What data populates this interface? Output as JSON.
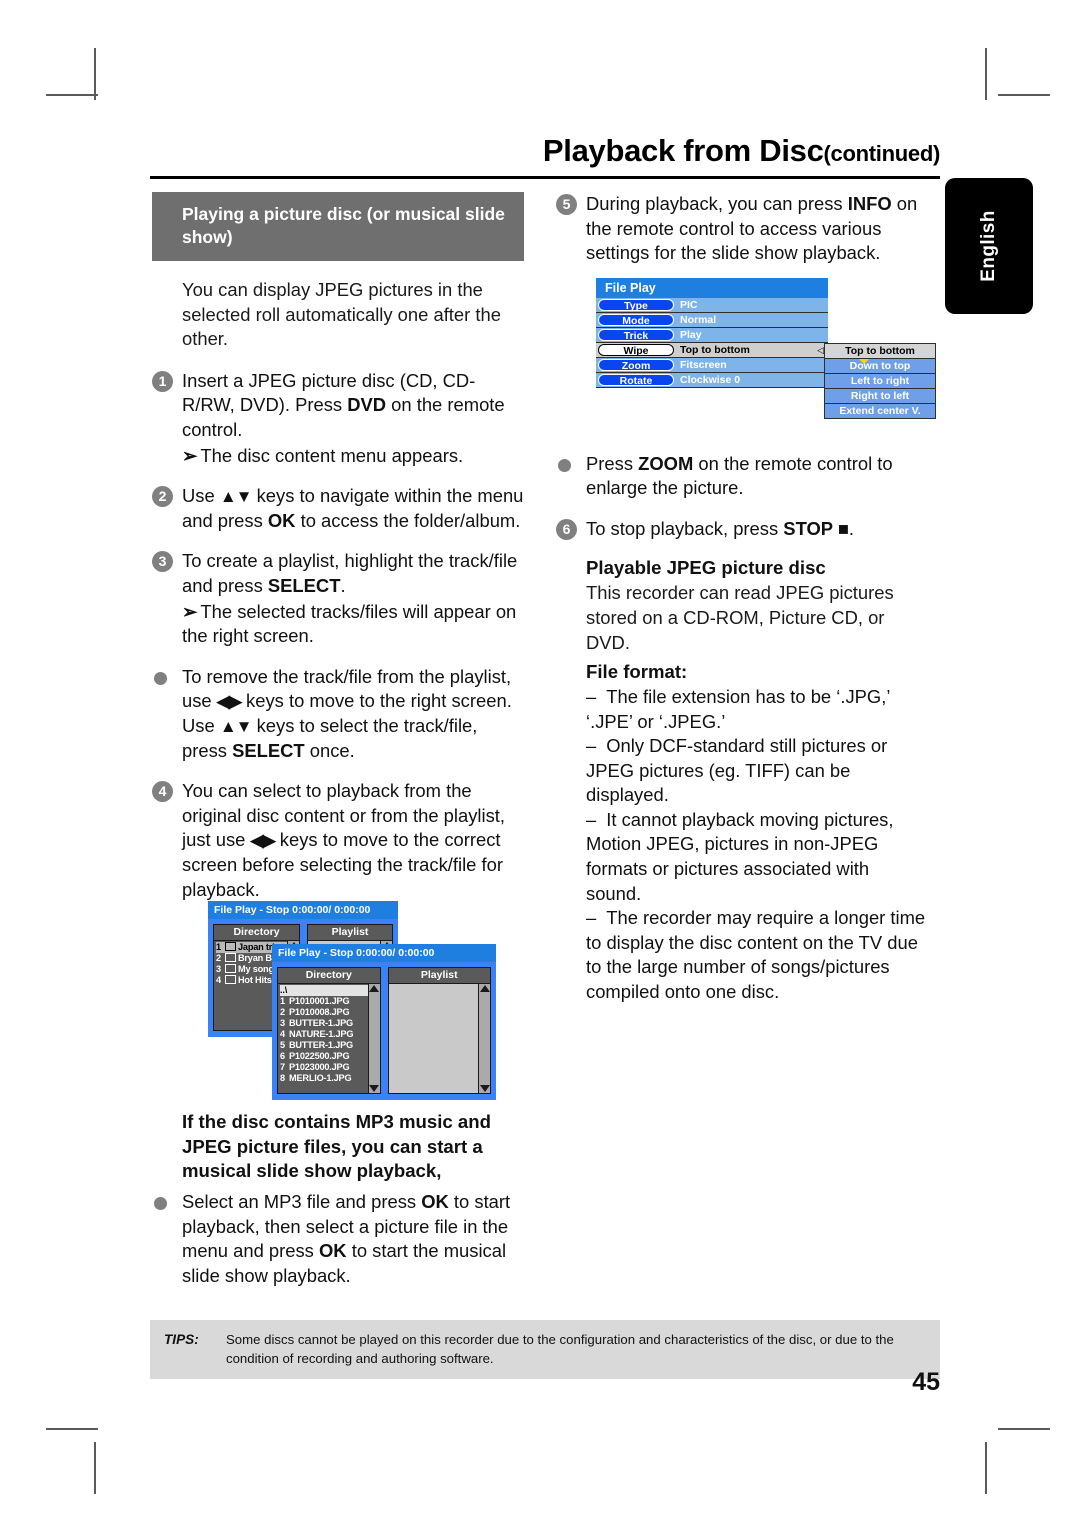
{
  "page": {
    "title": "Playback from Disc",
    "title_suffix": "(continued)",
    "number": "45",
    "language_tab": "English"
  },
  "left_column": {
    "section_heading": "Playing a picture disc (or musical slide show)",
    "intro": "You can display JPEG pictures in the selected roll automatically one after the other.",
    "steps": [
      {
        "marker": "1",
        "text_parts": [
          "Insert a JPEG picture disc (CD, CD-R/RW, DVD). Press ",
          "DVD",
          " on the remote control."
        ],
        "sub": "The disc content menu appears."
      },
      {
        "marker": "2",
        "text_parts": [
          "Use ",
          "▲▼",
          " keys to navigate within the menu and press ",
          "OK",
          " to access the folder/album."
        ]
      },
      {
        "marker": "3",
        "text_parts": [
          "To create a playlist, highlight the track/file and press ",
          "SELECT",
          "."
        ],
        "sub": "The selected tracks/files will appear on the right screen."
      },
      {
        "marker": "bullet",
        "text_parts": [
          "To remove the track/file from the playlist, use ",
          "◀▶",
          " keys to move to the right screen. Use ",
          "▲▼",
          " keys to select the track/file, press ",
          "SELECT",
          " once."
        ]
      },
      {
        "marker": "4",
        "text_parts": [
          "You can select to playback from the original disc content or from the playlist, just use ",
          "◀▶",
          " keys to move to the correct screen before selecting the track/file for playback."
        ]
      }
    ],
    "mp3_heading": "If the disc contains MP3 music and JPEG picture files, you can start a musical slide show playback,",
    "mp3_bullet_parts": [
      "Select an MP3 file and press ",
      "OK",
      " to start playback, then select a picture file in the menu and press ",
      "OK",
      " to start the musical slide show playback."
    ]
  },
  "right_column": {
    "step5": {
      "marker": "5",
      "text_parts": [
        "During playback, you can press ",
        "INFO",
        " on the remote control to access various settings for the slide show playback."
      ]
    },
    "zoom_bullet_parts": [
      "Press ",
      "ZOOM",
      " on the remote control to enlarge the picture."
    ],
    "step6": {
      "marker": "6",
      "text_parts": [
        "To stop playback, press ",
        "STOP ■",
        "."
      ]
    },
    "jpeg_heading": "Playable JPEG picture disc",
    "jpeg_text": "This recorder can read JPEG pictures stored on a CD-ROM, Picture CD, or DVD.",
    "file_format_heading": "File format:",
    "file_format_items": [
      "The file extension has to be ‘.JPG,’ ‘.JPE’ or ‘.JPEG.’",
      "Only DCF-standard still pictures or JPEG pictures (eg. TIFF) can be displayed.",
      "It cannot playback moving pictures, Motion JPEG, pictures in non-JPEG formats or pictures associated with sound.",
      "The recorder may require a longer time to display the disc content on the TV due to the large number of songs/pictures compiled onto one disc."
    ]
  },
  "osd_settings_menu": {
    "title": "File Play",
    "rows": [
      {
        "label": "Type",
        "value": "PIC",
        "selected": false
      },
      {
        "label": "Mode",
        "value": "Normal",
        "selected": false
      },
      {
        "label": "Trick",
        "value": "Play",
        "selected": false
      },
      {
        "label": "Wipe",
        "value": "Top to bottom",
        "selected": true
      },
      {
        "label": "Zoom",
        "value": "Fitscreen",
        "selected": false
      },
      {
        "label": "Rotate",
        "value": "Clockwise 0",
        "selected": false
      }
    ],
    "submenu": [
      {
        "label": "Top to bottom",
        "selected": true
      },
      {
        "label": "Down to top",
        "selected": false
      },
      {
        "label": "Left to right",
        "selected": false
      },
      {
        "label": "Right to left",
        "selected": false
      },
      {
        "label": "Extend center V.",
        "selected": false
      }
    ]
  },
  "osd_browser_back": {
    "title": "File Play - Stop 0:00:00/ 0:00:00",
    "directory_header": "Directory",
    "playlist_header": "Playlist",
    "directory_items": [
      {
        "num": "1",
        "name": "Japan trip",
        "folder": true,
        "highlighted": true
      },
      {
        "num": "2",
        "name": "Bryan Bday",
        "folder": true,
        "highlighted": false
      },
      {
        "num": "3",
        "name": "My songs",
        "folder": true,
        "highlighted": false
      },
      {
        "num": "4",
        "name": "Hot Hits",
        "folder": true,
        "highlighted": false
      }
    ]
  },
  "osd_browser_front": {
    "title": "File Play - Stop 0:00:00/ 0:00:00",
    "directory_header": "Directory",
    "playlist_header": "Playlist",
    "updir": "..\\",
    "directory_items": [
      {
        "num": "1",
        "name": "P1010001.JPG"
      },
      {
        "num": "2",
        "name": "P1010008.JPG"
      },
      {
        "num": "3",
        "name": "BUTTER-1.JPG"
      },
      {
        "num": "4",
        "name": "NATURE-1.JPG"
      },
      {
        "num": "5",
        "name": "BUTTER-1.JPG"
      },
      {
        "num": "6",
        "name": "P1022500.JPG"
      },
      {
        "num": "7",
        "name": "P1023000.JPG"
      },
      {
        "num": "8",
        "name": "MERLIO-1.JPG"
      }
    ]
  },
  "tips": {
    "label": "TIPS:",
    "text": "Some discs cannot be played on this recorder due to the configuration and characteristics of the disc, or due to the condition of recording and authoring software."
  },
  "colors": {
    "heading_bar": "#6f6f6f",
    "osd_title_blue": "#1f7fe0",
    "osd_body_blue": "#7fb4e8",
    "osd_pill_blue": "#0a46f0",
    "tips_bg": "#d9d9d9",
    "marker_gray": "#808080"
  }
}
